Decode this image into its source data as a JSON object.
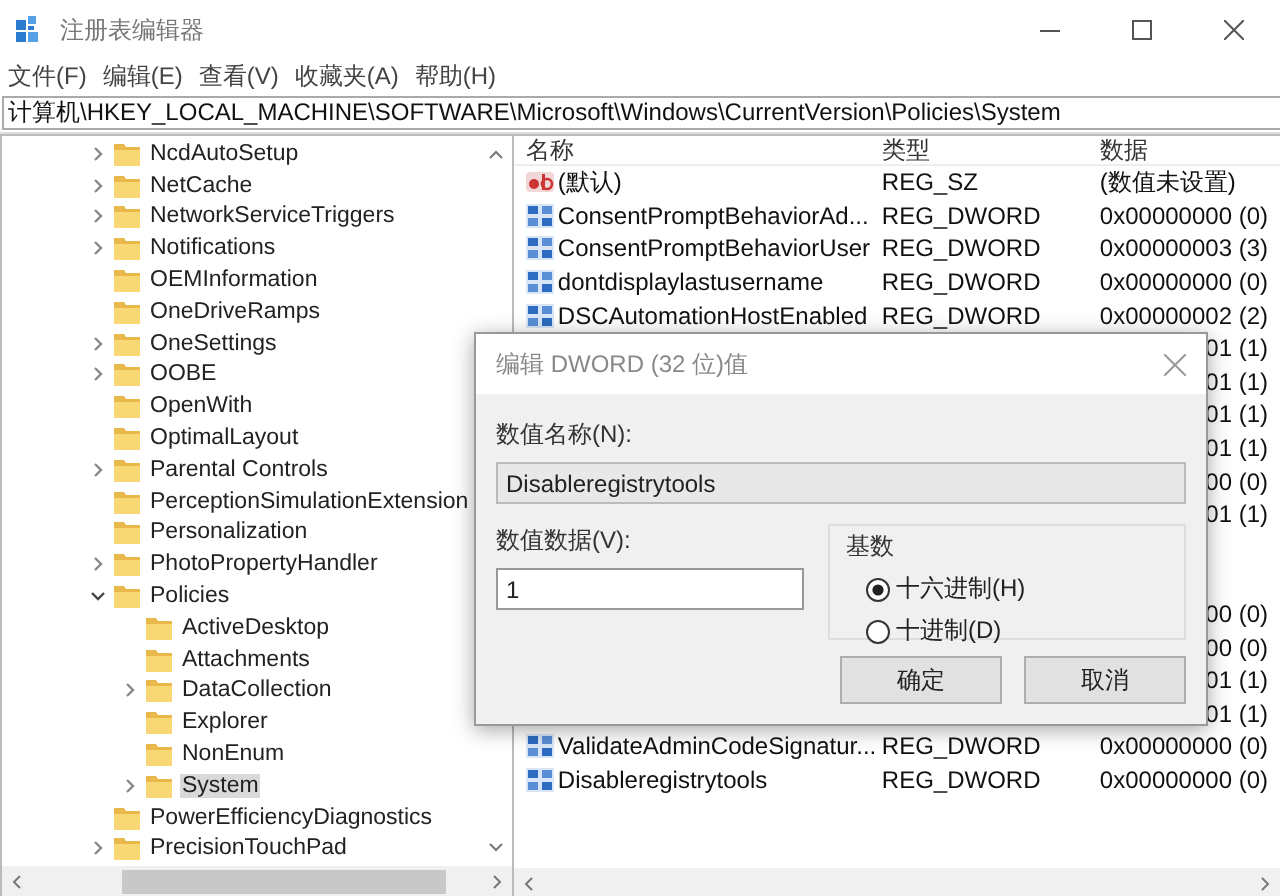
{
  "window": {
    "title": "注册表编辑器"
  },
  "menu": [
    "文件(F)",
    "编辑(E)",
    "查看(V)",
    "收藏夹(A)",
    "帮助(H)"
  ],
  "address": "计算机\\HKEY_LOCAL_MACHINE\\SOFTWARE\\Microsoft\\Windows\\CurrentVersion\\Policies\\System",
  "tree": [
    {
      "label": "NcdAutoSetup",
      "expanded": false,
      "selected": false
    },
    {
      "label": "NetCache",
      "expanded": false,
      "selected": false
    },
    {
      "label": "NetworkServiceTriggers",
      "expanded": false,
      "selected": false
    },
    {
      "label": "Notifications",
      "expanded": false,
      "selected": false
    },
    {
      "label": "OEMInformation",
      "selected": false
    },
    {
      "label": "OneDriveRamps",
      "selected": false
    },
    {
      "label": "OneSettings",
      "expanded": false,
      "selected": false
    },
    {
      "label": "OOBE",
      "expanded": false,
      "selected": false
    },
    {
      "label": "OpenWith",
      "selected": false
    },
    {
      "label": "OptimalLayout",
      "selected": false
    },
    {
      "label": "Parental Controls",
      "expanded": false,
      "selected": false
    },
    {
      "label": "PerceptionSimulationExtension",
      "selected": false
    },
    {
      "label": "Personalization",
      "selected": false
    },
    {
      "label": "PhotoPropertyHandler",
      "expanded": false,
      "selected": false
    },
    {
      "label": "Policies",
      "expanded": true,
      "selected": false,
      "children": [
        {
          "label": "ActiveDesktop",
          "selected": false
        },
        {
          "label": "Attachments",
          "selected": false
        },
        {
          "label": "DataCollection",
          "expanded": false,
          "selected": false
        },
        {
          "label": "Explorer",
          "selected": false
        },
        {
          "label": "NonEnum",
          "selected": false
        },
        {
          "label": "System",
          "expanded": false,
          "selected": true
        }
      ]
    },
    {
      "label": "PowerEfficiencyDiagnostics",
      "selected": false
    },
    {
      "label": "PrecisionTouchPad",
      "expanded": false,
      "selected": false
    }
  ],
  "list": {
    "columns": [
      "名称",
      "类型",
      "数据"
    ],
    "rows": [
      {
        "kind": "string",
        "name": "(默认)",
        "type": "REG_SZ",
        "data": "(数值未设置)"
      },
      {
        "kind": "dword",
        "name": "ConsentPromptBehaviorAd...",
        "type": "REG_DWORD",
        "data": "0x00000000 (0)"
      },
      {
        "kind": "dword",
        "name": "ConsentPromptBehaviorUser",
        "type": "REG_DWORD",
        "data": "0x00000003 (3)"
      },
      {
        "kind": "dword",
        "name": "dontdisplaylastusername",
        "type": "REG_DWORD",
        "data": "0x00000000 (0)"
      },
      {
        "kind": "dword",
        "name": "DSCAutomationHostEnabled",
        "type": "REG_DWORD",
        "data": "0x00000002 (2)"
      },
      {
        "kind": "covered",
        "data": "01 (1)"
      },
      {
        "kind": "covered",
        "data": "01 (1)"
      },
      {
        "kind": "covered",
        "data": "01 (1)"
      },
      {
        "kind": "covered",
        "data": "01 (1)"
      },
      {
        "kind": "covered",
        "data": "00 (0)"
      },
      {
        "kind": "covered",
        "data": "01 (1)"
      },
      {
        "kind": "covered"
      },
      {
        "kind": "covered"
      },
      {
        "kind": "covered",
        "data": "00 (0)"
      },
      {
        "kind": "covered",
        "data": "00 (0)"
      },
      {
        "kind": "covered",
        "data": "01 (1)"
      },
      {
        "kind": "covered",
        "data": "01 (1)"
      },
      {
        "kind": "dword",
        "name": "ValidateAdminCodeSignatur...",
        "type": "REG_DWORD",
        "data": "0x00000000 (0)"
      },
      {
        "kind": "dword",
        "name": "Disableregistrytools",
        "type": "REG_DWORD",
        "data": "0x00000000 (0)"
      }
    ]
  },
  "dialog": {
    "title": "编辑 DWORD (32 位)值",
    "name_label": "数值名称(N):",
    "name_value": "Disableregistrytools",
    "data_label": "数值数据(V):",
    "data_value": "1",
    "base_label": "基数",
    "radios": [
      {
        "label": "十六进制(H)",
        "selected": true
      },
      {
        "label": "十进制(D)",
        "selected": false
      }
    ],
    "buttons": [
      "确定",
      "取消"
    ]
  }
}
